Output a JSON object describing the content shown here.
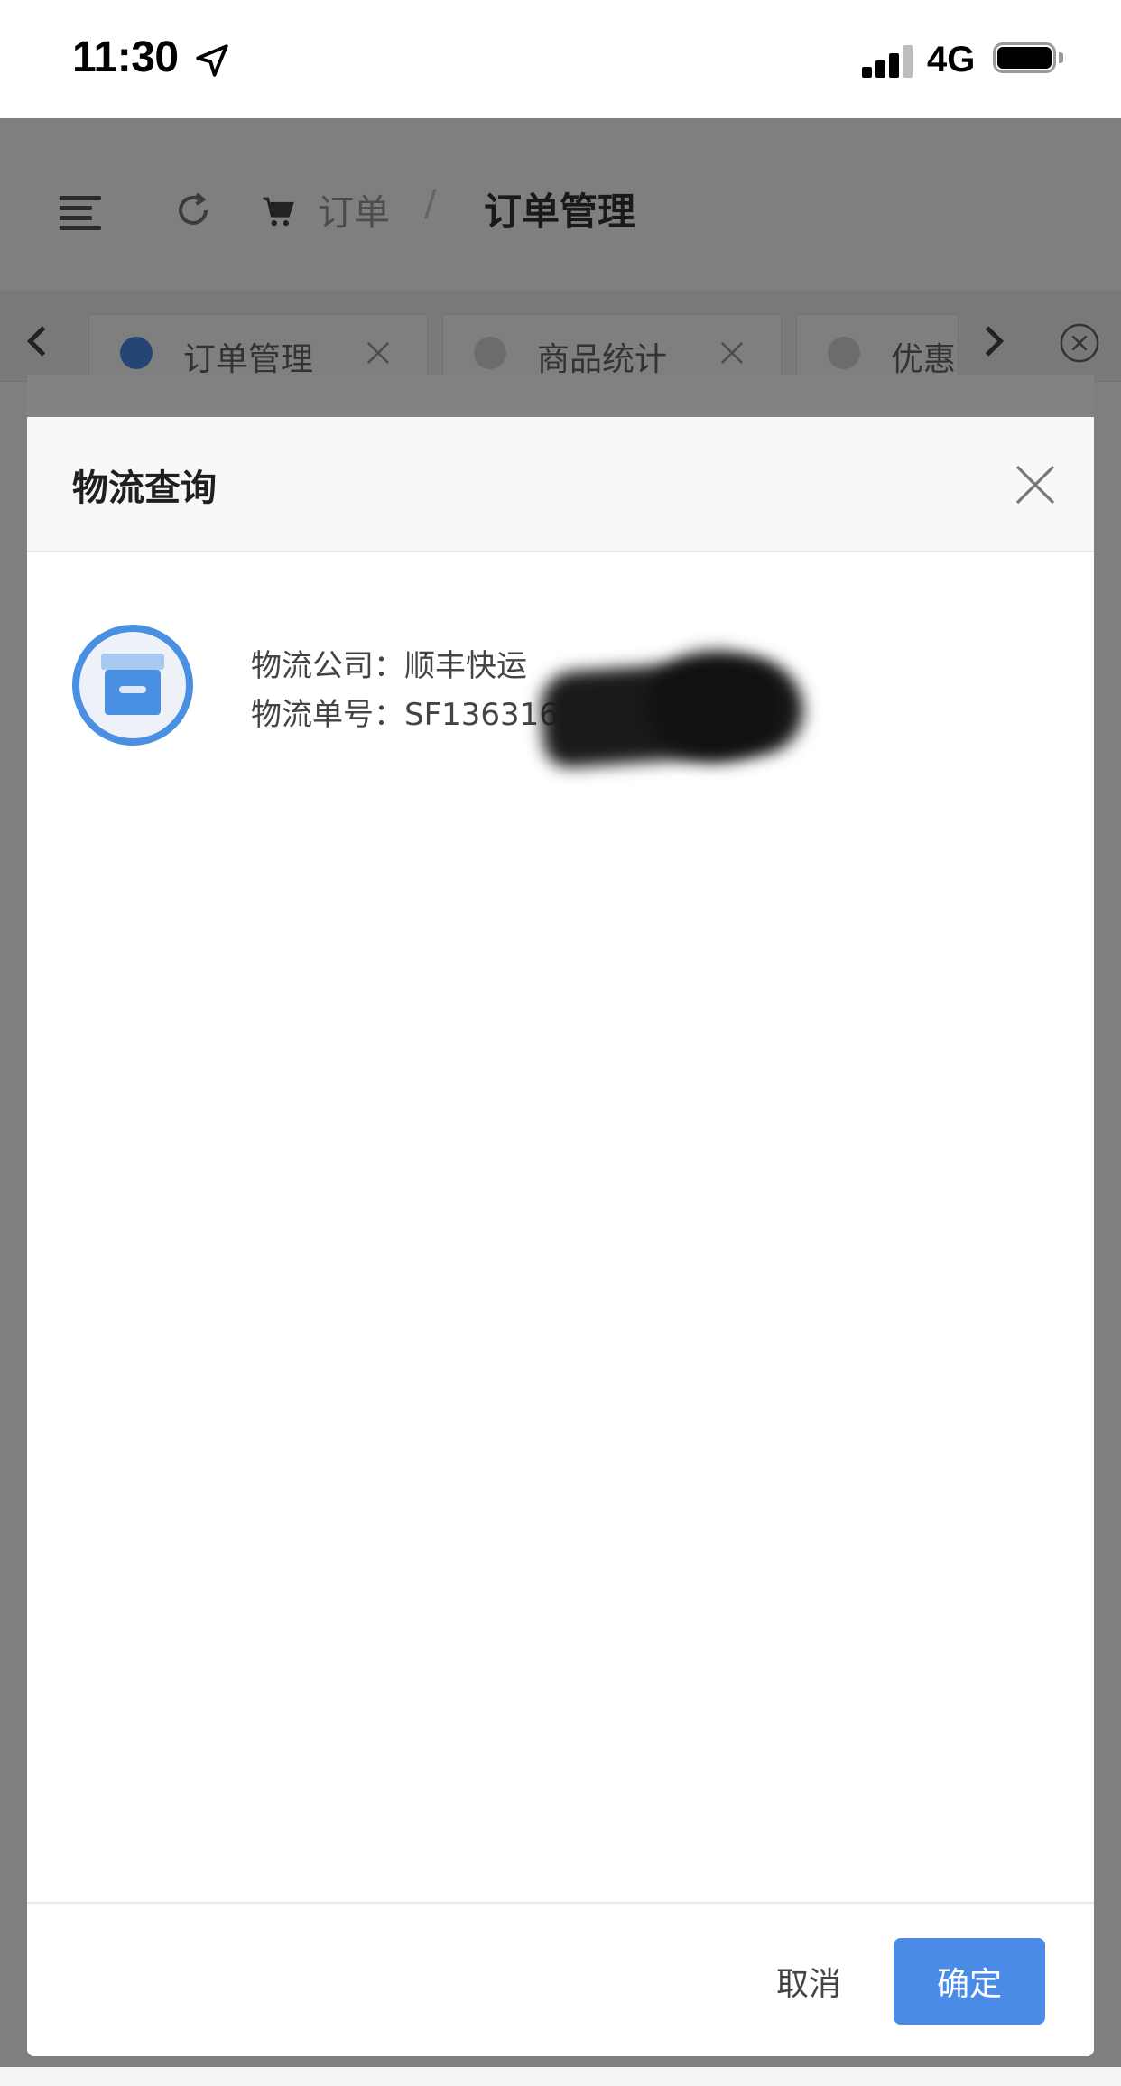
{
  "status_bar": {
    "time": "11:30",
    "network": "4G"
  },
  "header": {
    "breadcrumb": [
      "订单",
      "订单管理"
    ],
    "breadcrumb_separator": "/"
  },
  "tabs": [
    {
      "label": "订单管理",
      "active": true
    },
    {
      "label": "商品统计",
      "active": false
    },
    {
      "label": "优惠",
      "active": false
    }
  ],
  "modal": {
    "title": "物流查询",
    "logistics_company_label": "物流公司：",
    "logistics_company_value": "顺丰快运",
    "tracking_number_label": "物流单号：",
    "tracking_number_value": "SF1363165040377",
    "cancel_label": "取消",
    "confirm_label": "确定"
  },
  "colors": {
    "primary": "#4a8be8",
    "icon_blue": "#4a90e2",
    "overlay": "rgba(0,0,0,0.5)"
  }
}
